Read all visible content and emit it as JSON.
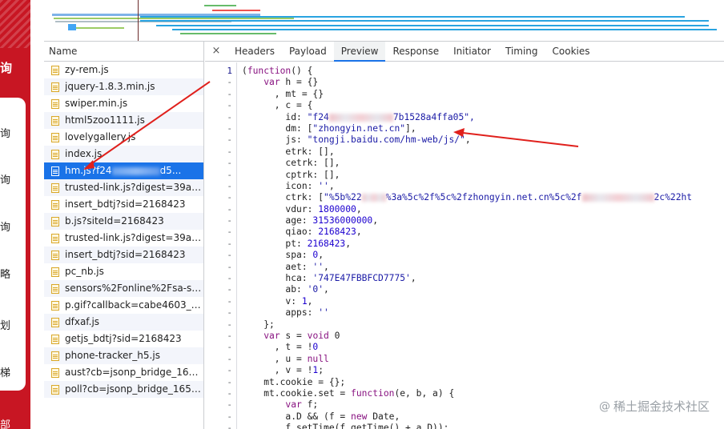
{
  "site": {
    "top_text": "询",
    "items": [
      "询",
      "询",
      "询",
      "略",
      "划",
      "梯"
    ],
    "bottom_text": "部"
  },
  "network": {
    "name_header": "Name",
    "files": [
      "zy-rem.js",
      "jquery-1.8.3.min.js",
      "swiper.min.js",
      "html5zoo1111.js",
      "lovelygallery.js",
      "index.js",
      "hm.js?f24",
      "trusted-link.js?digest=39a7ce...",
      "insert_bdtj?sid=2168423",
      "b.js?siteId=2168423",
      "trusted-link.js?digest=39a7ce...",
      "insert_bdtj?sid=2168423",
      "pc_nb.js",
      "sensors%2Fonline%2Fsa-sdk-j...",
      "p.gif?callback=cabe4603_598...",
      "dfxaf.js",
      "getjs_bdtj?sid=2168423",
      "phone-tracker_h5.js",
      "aust?cb=jsonp_bridge_16538...",
      "poll?cb=jsonp_bridge_165383..."
    ],
    "selected_index": 6,
    "selected_suffix": "d5..."
  },
  "tabs": {
    "close_glyph": "×",
    "items": [
      "Headers",
      "Payload",
      "Preview",
      "Response",
      "Initiator",
      "Timing",
      "Cookies"
    ],
    "active": "Preview"
  },
  "code": {
    "first_line_number": "1",
    "gutter_marker": "-",
    "lines": [
      "(function() {",
      "    var h = {}",
      "      , mt = {}",
      "      , c = {",
      "        id: \"f24",
      "        dm: [\"zhongyin.net.cn\"],",
      "        js: \"tongji.baidu.com/hm-web/js/\",",
      "        etrk: [],",
      "        cetrk: [],",
      "        cptrk: [],",
      "        icon: '',",
      "        ctrk: [\"%5b%22",
      "        vdur: 1800000,",
      "        age: 31536000000,",
      "        qiao: 2168423,",
      "        pt: 2168423,",
      "        spa: 0,",
      "        aet: '',",
      "        hca: '747E47FBBFCD7775',",
      "        ab: '0',",
      "        v: 1,",
      "        apps: ''",
      "    };",
      "    var s = void 0",
      "      , t = !0",
      "      , u = null",
      "      , v = !1;",
      "    mt.cookie = {};",
      "    mt.cookie.set = function(e, b, a) {",
      "        var f;",
      "        a.D && (f = new Date,",
      "        f.setTime(f.getTime() + a.D));"
    ],
    "id_tail": "7b1528a4ffa05\",",
    "ctrk_mid": "%3a%5c%2f%5c%2fzhongyin.net.cn%5c%2f",
    "ctrk_tail": "2c%22ht"
  },
  "watermark": {
    "icon": "@",
    "text": "稀土掘金技术社区"
  },
  "colors": {
    "site_red": "#c81623",
    "selection_blue": "#1a73e8",
    "arrow_red": "#e0201c"
  }
}
